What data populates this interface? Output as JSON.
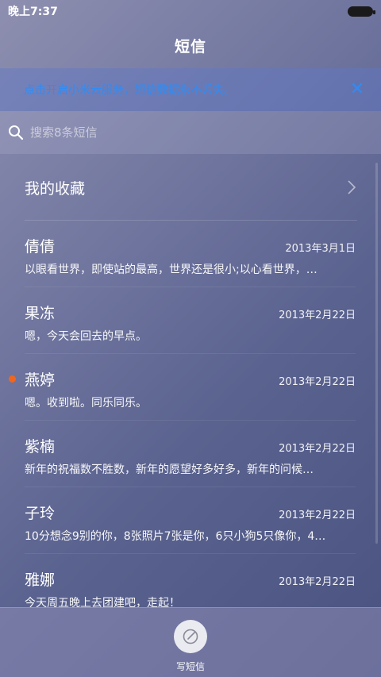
{
  "status": {
    "time": "晚上7:37"
  },
  "header": {
    "title": "短信"
  },
  "banner": {
    "text": "点击开启小米云服务，短信数据永不丢失。",
    "close_icon": "close-icon"
  },
  "search": {
    "placeholder": "搜索8条短信",
    "icon": "search-icon"
  },
  "favorites": {
    "label": "我的收藏",
    "icon": "chevron-right-icon"
  },
  "conversations": [
    {
      "name": "倩倩",
      "date": "2013年3月1日",
      "preview": "以眼看世界，即使站的最高，世界还是很小;以心看世界，…",
      "unread": false
    },
    {
      "name": "果冻",
      "date": "2013年2月22日",
      "preview": "嗯，今天会回去的早点。",
      "unread": false
    },
    {
      "name": "燕婷",
      "date": "2013年2月22日",
      "preview": "嗯。收到啦。同乐同乐。",
      "unread": true
    },
    {
      "name": "紫楠",
      "date": "2013年2月22日",
      "preview": "新年的祝福数不胜数，新年的愿望好多好多，新年的问候…",
      "unread": false
    },
    {
      "name": "子玲",
      "date": "2013年2月22日",
      "preview": "10分想念9别的你，8张照片7张是你，6只小狗5只像你，4…",
      "unread": false
    },
    {
      "name": "雅娜",
      "date": "2013年2月22日",
      "preview": "今天周五晚上去团建吧，走起！",
      "unread": false
    }
  ],
  "bottom": {
    "compose_label": "写短信",
    "compose_icon": "compose-icon"
  },
  "colors": {
    "accent": "#2f8cf5",
    "unread": "#f0661e"
  }
}
